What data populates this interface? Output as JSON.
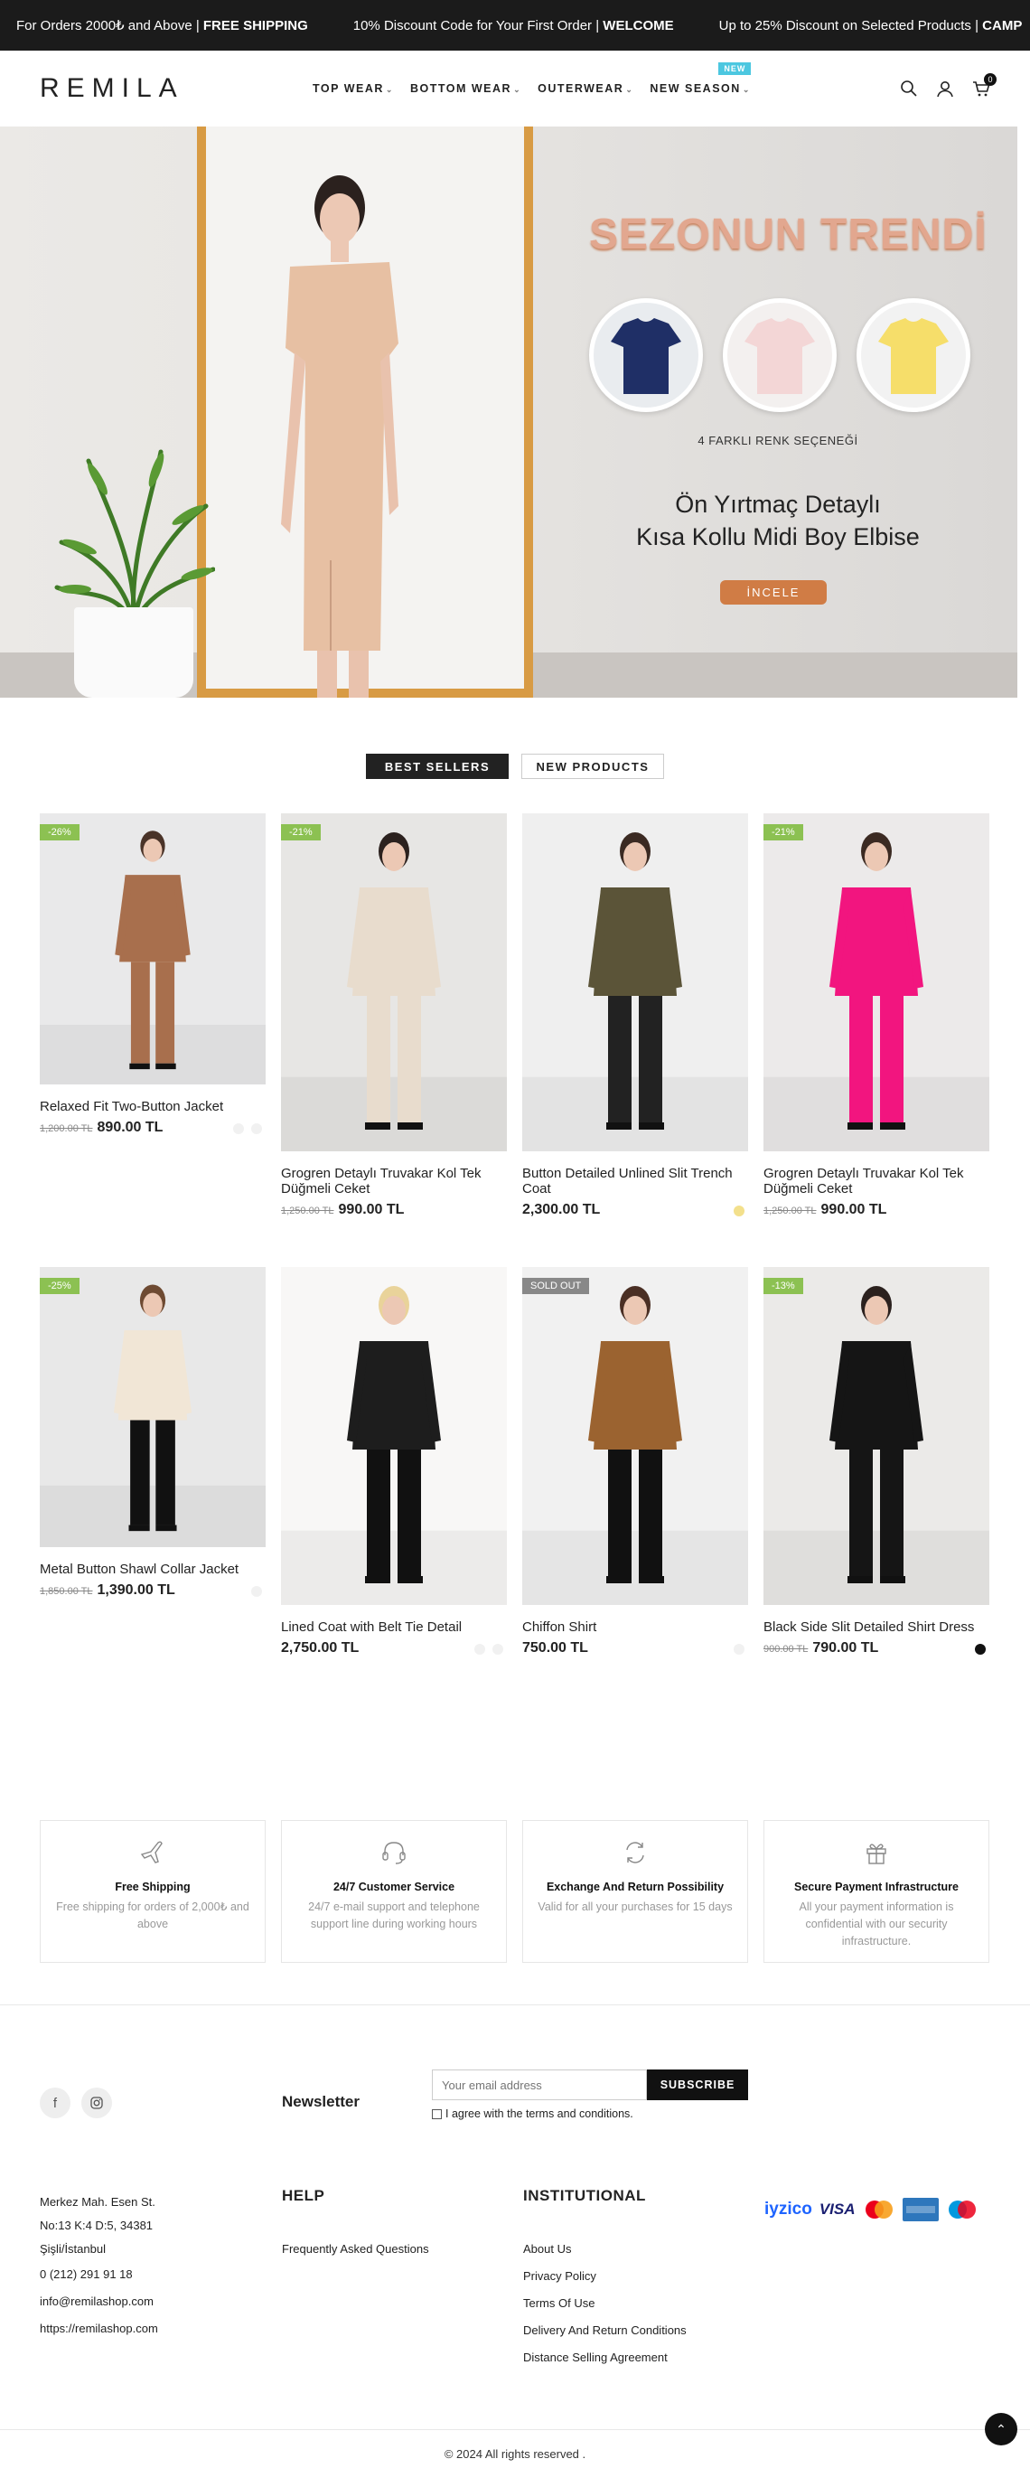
{
  "topbar": {
    "m1_text": "For Orders 2000₺ and Above | ",
    "m1_bold": "FREE SHIPPING",
    "m2_text": "10% Discount Code for Your First Order | ",
    "m2_bold": "WELCOME",
    "m3_text": "Up to 25% Discount on Selected Products | ",
    "m3_bold": "CAMP"
  },
  "header": {
    "logo": "REMILA",
    "nav": [
      "TOP WEAR",
      "BOTTOM WEAR",
      "OUTERWEAR",
      "NEW SEASON"
    ],
    "new_badge": "NEW",
    "cart_count": "0"
  },
  "hero": {
    "title": "SEZONUN TRENDİ",
    "colors_text": "4 FARKLI RENK SEÇENEĞİ",
    "subtitle_line1": "Ön Yırtmaç Detaylı",
    "subtitle_line2": "Kısa Kollu Midi Boy Elbise",
    "button": "İNCELE",
    "swatches": [
      "#1f2f66",
      "#f3dada",
      "#f6de6a"
    ]
  },
  "tabs": [
    "BEST SELLERS",
    "NEW PRODUCTS"
  ],
  "products": [
    {
      "badge": "-26%",
      "name": "Relaxed Fit Two-Button Jacket",
      "old": "1,200.00 TL",
      "price": "890.00 TL",
      "colors": [
        "#f1f1f1",
        "#f1f1f1"
      ]
    },
    {
      "badge": "-21%",
      "name": "Grogren Detaylı Truvakar Kol Tek Düğmeli Ceket",
      "old": "1,250.00 TL",
      "price": "990.00 TL",
      "colors": []
    },
    {
      "badge": "",
      "name": "Button Detailed Unlined Slit Trench Coat",
      "old": "",
      "price": "2,300.00 TL",
      "colors": [
        "#f3e08c"
      ]
    },
    {
      "badge": "-21%",
      "name": "Grogren Detaylı Truvakar Kol Tek Düğmeli Ceket",
      "old": "1,250.00 TL",
      "price": "990.00 TL",
      "colors": []
    },
    {
      "badge": "-25%",
      "name": "Metal Button Shawl Collar Jacket",
      "old": "1,850.00 TL",
      "price": "1,390.00 TL",
      "colors": [
        "#f1f1f1"
      ]
    },
    {
      "badge": "",
      "name": "Lined Coat with Belt Tie Detail",
      "old": "",
      "price": "2,750.00 TL",
      "colors": [
        "#f1f1f1",
        "#f1f1f1"
      ]
    },
    {
      "badge": "SOLD OUT",
      "name": "Chiffon Shirt",
      "old": "",
      "price": "750.00 TL",
      "colors": [
        "#f1f1f1"
      ]
    },
    {
      "badge": "-13%",
      "name": "Black Side Slit Detailed Shirt Dress",
      "old": "900.00 TL",
      "price": "790.00 TL",
      "colors": [
        "#111111"
      ]
    }
  ],
  "features": [
    {
      "icon": "plane-icon",
      "title": "Free Shipping",
      "desc": "Free shipping for orders of 2,000₺ and above"
    },
    {
      "icon": "headset-icon",
      "title": "24/7 Customer Service",
      "desc": "24/7 e-mail support and telephone support line during working hours"
    },
    {
      "icon": "exchange-icon",
      "title": "Exchange And Return Possibility",
      "desc": "Valid for all your purchases for 15 days"
    },
    {
      "icon": "gift-icon",
      "title": "Secure Payment Infrastructure",
      "desc": "All your payment information is confidential with our security infrastructure."
    }
  ],
  "newsletter": {
    "title": "Newsletter",
    "placeholder": "Your email address",
    "button": "SUBSCRIBE",
    "agree": "I agree with the terms and conditions."
  },
  "footer": {
    "address": [
      "Merkez Mah. Esen St.",
      "No:13 K:4 D:5, 34381",
      "Şişli/İstanbul",
      "0 (212) 291 91 18",
      "info@remilashop.com",
      "https://remilashop.com"
    ],
    "help_title": "HELP",
    "help_links": [
      "Frequently Asked Questions"
    ],
    "inst_title": "INSTITUTIONAL",
    "inst_links": [
      "About Us",
      "Privacy Policy",
      "Terms Of Use",
      "Delivery And Return Conditions",
      "Distance Selling Agreement"
    ],
    "payments": [
      "iyzico",
      "VISA"
    ],
    "copyright": "© 2024 All rights reserved ."
  }
}
